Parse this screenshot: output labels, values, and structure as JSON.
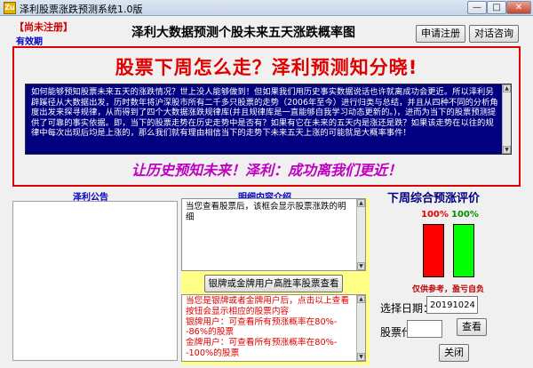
{
  "window": {
    "title": "泽利股票涨跌预测系统1.0版",
    "app_icon_text": "Zu",
    "minimize_glyph": "—",
    "maximize_glyph": "□",
    "close_glyph": "✕"
  },
  "header": {
    "status": "【尚未注册】",
    "valid_label": "有效期",
    "heading": "泽利大数据预测个股未来五天涨跌概率图",
    "register_button": "申请注册",
    "consult_button": "对话咨询"
  },
  "banner": {
    "title": "股票下周怎么走？泽利预测知分晓!",
    "description": "如何能够预知股票未来五天的涨跌情况？世上没人能够做到！但如果我们用历史事实数据说话也许就离成功会更近。所以泽利另辟蹊径从大数据出发，历时数年将沪深股市所有二千多只股票的走势（2006年至今）进行归类与总结，并且从四种不同的分析角度出发来探寻规律，从而得到了四个大数据涨跌规律库(并且规律库是一直能够自我学习动态更新的。)，进而为当下的股票预测提供了可靠的事实依据。即，当下的股票走势在历史走势中是否有？如果有它在未来的五天内是涨还是跌？如果该走势在以往的规律中每次出现后均是上涨的，那么我们就有理由相信当下的走势下未来五天上涨的可能就是大概率事件！",
    "slogan": "让历史预知未来！泽利：成功离我们更近！",
    "scroll_up_glyph": "▲",
    "scroll_down_glyph": "▼"
  },
  "notice": {
    "label": "泽利公告"
  },
  "detail": {
    "label": "明细内容介绍",
    "text": "当您查看股票后，该框会显示股票涨跌的明细"
  },
  "premium": {
    "button": "银牌或金牌用户高胜率股票查看",
    "text": "当您是银牌或者金牌用户后，点击以上查看按钮会显示相应的股票内容\n银牌用户：可查看所有预涨概率在80%--86%的股票\n金牌用户：可查看所有预涨概率在80%--100%的股票"
  },
  "rating": {
    "title": "下周综合预涨评价",
    "down_pct_label": "100%",
    "up_pct_label": "100%",
    "down_color": "#ff0000",
    "up_color": "#00ff00",
    "disclaimer": "仅供参考，盈亏自负",
    "date_label": "选择日期：",
    "date_value": "20191024",
    "code_label": "股票代码：",
    "code_value": "",
    "query_button": "查看",
    "close_button": "关闭"
  }
}
